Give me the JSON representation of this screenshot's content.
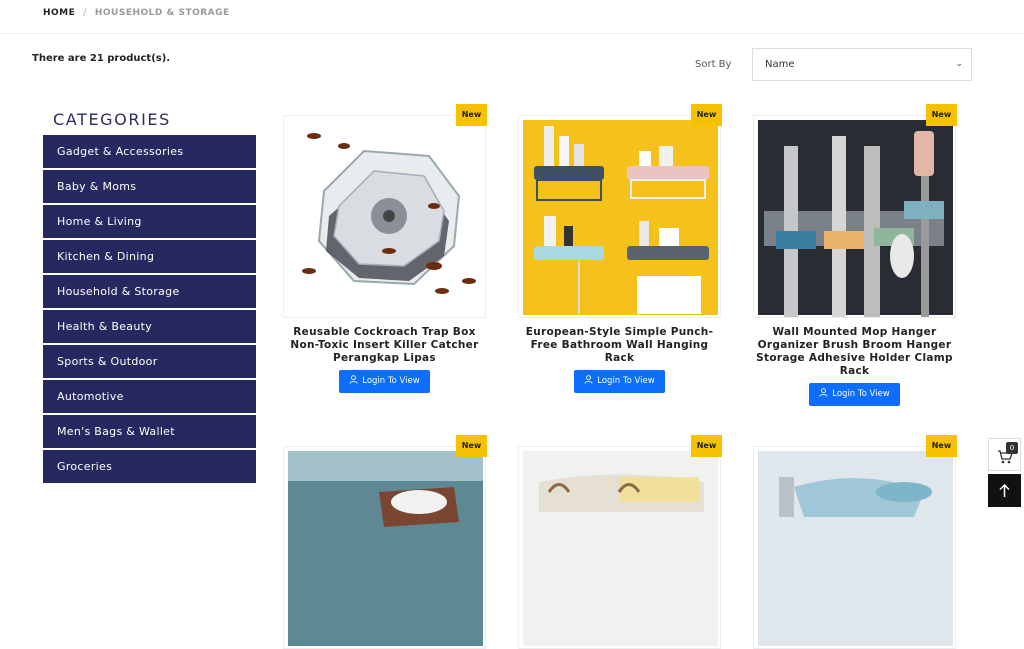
{
  "breadcrumb": {
    "home": "HOME",
    "separator": "/",
    "current": "HOUSEHOLD & STORAGE"
  },
  "listing": {
    "count_text": "There are 21 product(s).",
    "sort_label": "Sort By",
    "sort_value": "Name"
  },
  "categories": {
    "title": "CATEGORIES",
    "items": [
      "Gadget & Accessories",
      "Baby & Moms",
      "Home & Living",
      "Kitchen & Dining",
      "Household & Storage",
      "Health & Beauty",
      "Sports & Outdoor",
      "Automotive",
      "Men's Bags & Wallet",
      "Groceries"
    ]
  },
  "products": [
    {
      "badge": "New",
      "title": "Reusable Cockroach Trap Box Non-Toxic Insert Killer Catcher Perangkap Lipas",
      "button": "Login To View"
    },
    {
      "badge": "New",
      "title": "European-Style Simple Punch-Free Bathroom Wall Hanging Rack",
      "button": "Login To View"
    },
    {
      "badge": "New",
      "title": "Wall Mounted Mop Hanger Organizer Brush Broom Hanger Storage Adhesive Holder Clamp Rack",
      "button": "Login To View"
    },
    {
      "badge": "New"
    },
    {
      "badge": "New"
    },
    {
      "badge": "New"
    }
  ],
  "cart": {
    "count": "0"
  },
  "colors": {
    "category_bg": "#272860",
    "button_blue": "#0d6efd",
    "badge_yellow": "#f6c100"
  }
}
